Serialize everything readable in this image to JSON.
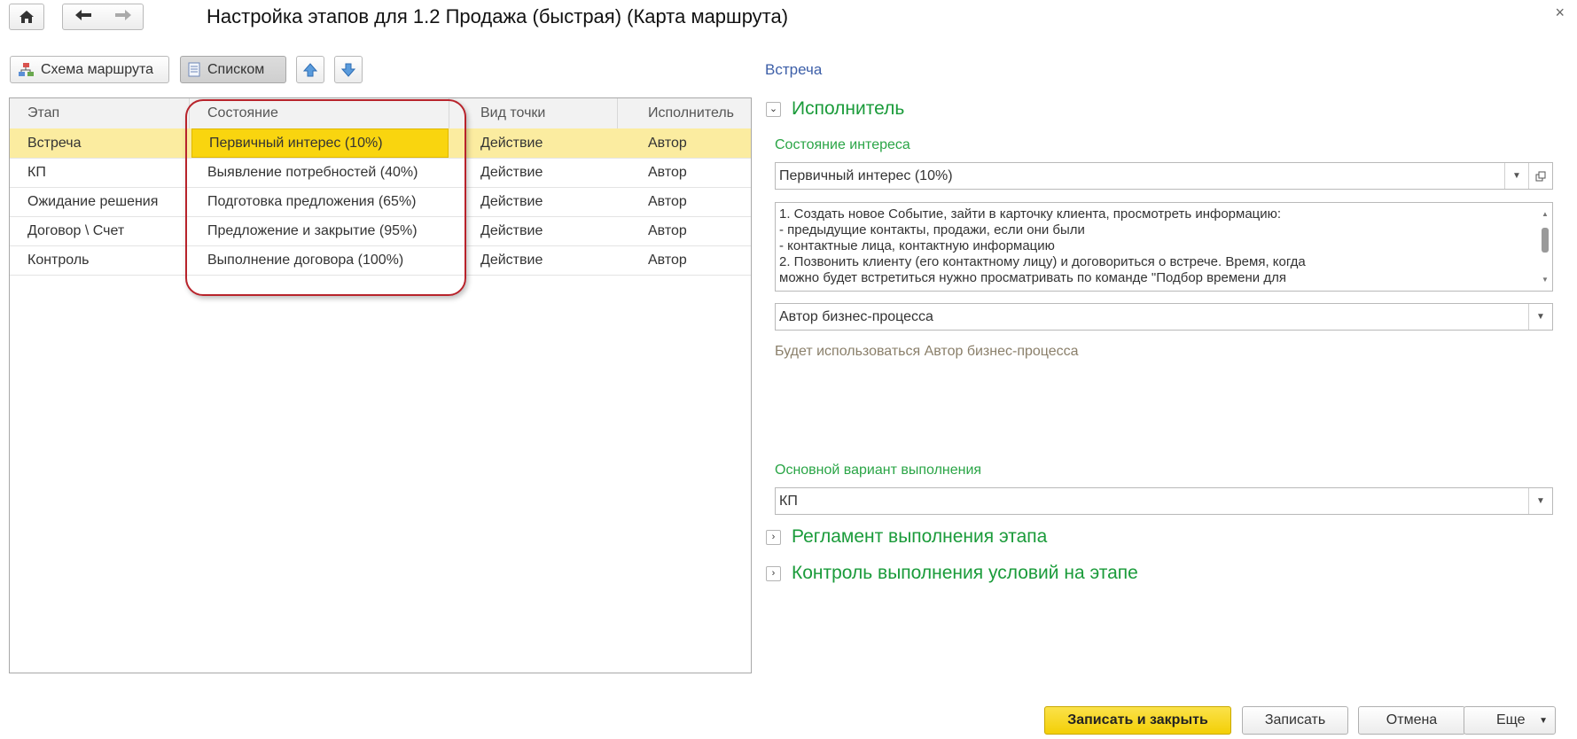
{
  "window": {
    "title": "Настройка этапов для 1.2 Продажа (быстрая) (Карта маршрута)",
    "close_glyph": "×"
  },
  "nav": {
    "home_icon": "home-icon",
    "back_icon": "arrow-left-icon",
    "forward_icon": "arrow-right-icon"
  },
  "toolbar": {
    "route_scheme_label": "Схема маршрута",
    "list_label": "Списком",
    "up_icon": "arrow-up-icon",
    "down_icon": "arrow-down-icon"
  },
  "table": {
    "columns": [
      "Этап",
      "Состояние",
      "Вид точки",
      "Исполнитель"
    ],
    "rows": [
      [
        "Встреча",
        "Первичный интерес (10%)",
        "Действие",
        "Автор"
      ],
      [
        "КП",
        "Выявление потребностей (40%)",
        "Действие",
        "Автор"
      ],
      [
        "Ожидание решения",
        "Подготовка предложения (65%)",
        "Действие",
        "Автор"
      ],
      [
        "Договор \\ Счет",
        "Предложение и закрытие (95%)",
        "Действие",
        "Автор"
      ],
      [
        "Контроль",
        "Выполнение договора (100%)",
        "Действие",
        "Автор"
      ]
    ],
    "selected_row": 0
  },
  "detail": {
    "section_title": "Встреча",
    "executor_group": "Исполнитель",
    "interest_label": "Состояние интереса",
    "interest_value": "Первичный интерес (10%)",
    "description_lines": [
      "1. Создать новое Событие, зайти в карточку клиента, просмотреть информацию:",
      "- предыдущие контакты, продажи, если они были",
      "- контактные лица, контактную информацию",
      "2. Позвонить клиенту (его контактному лицу) и договориться о встрече. Время, когда",
      "можно будет встретиться нужно просматривать по команде \"Подбор времени для"
    ],
    "executor_value": "Автор бизнес-процесса",
    "executor_hint": "Будет использоваться Автор бизнес-процесса",
    "main_variant_label": "Основной вариант выполнения",
    "main_variant_value": "КП",
    "reglament_group": "Регламент выполнения этапа",
    "control_group": "Контроль выполнения условий на этапе"
  },
  "footer": {
    "save_close": "Записать и закрыть",
    "save": "Записать",
    "cancel": "Отмена",
    "more": "Еще"
  }
}
